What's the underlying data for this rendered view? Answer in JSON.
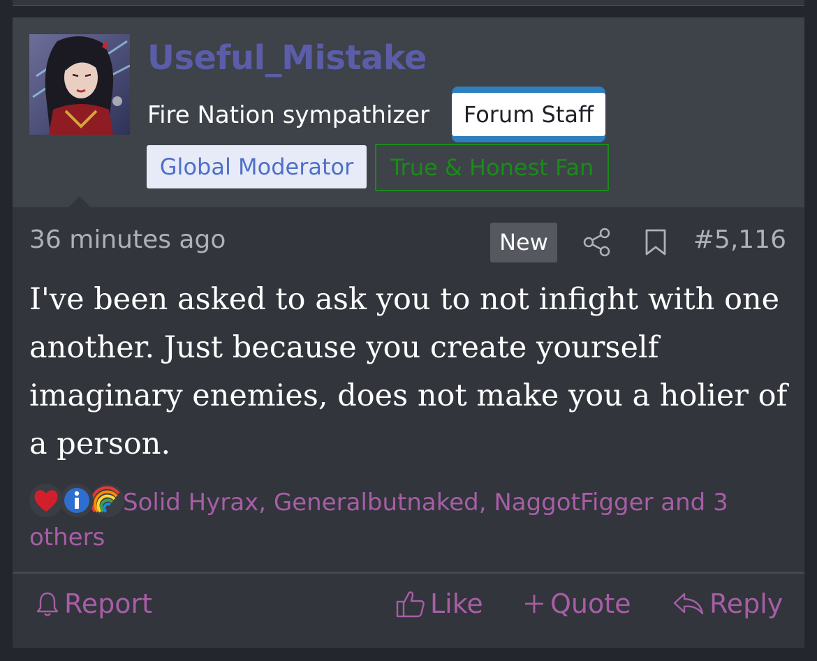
{
  "user": {
    "name": "Useful_Mistake",
    "title": "Fire Nation sympathizer",
    "badges": {
      "staff": "Forum Staff",
      "moderator": "Global Moderator",
      "fan": "True & Honest Fan"
    },
    "colors": {
      "username": "#5b5da8",
      "staff_accent": "#2e7fbe",
      "moderator_text": "#4f6fc8",
      "fan_text": "#1b8a1b"
    }
  },
  "meta": {
    "time": "36 minutes ago",
    "new_badge": "New",
    "post_number": "#5,116",
    "icons": [
      "share-icon",
      "bookmark-icon"
    ]
  },
  "message": {
    "text": "I've been asked to ask you to not infight with one another. Just because you create yourself imaginary enemies, does not make you a holier of a person."
  },
  "reactions": {
    "icons": [
      "heart-icon",
      "info-icon",
      "rainbow-icon"
    ],
    "text": "Solid Hyrax, Generalbutnaked, NaggotFigger and 3 others",
    "color": "#a75ea6"
  },
  "actions": {
    "report": "Report",
    "like": "Like",
    "quote": "Quote",
    "reply": "Reply"
  }
}
